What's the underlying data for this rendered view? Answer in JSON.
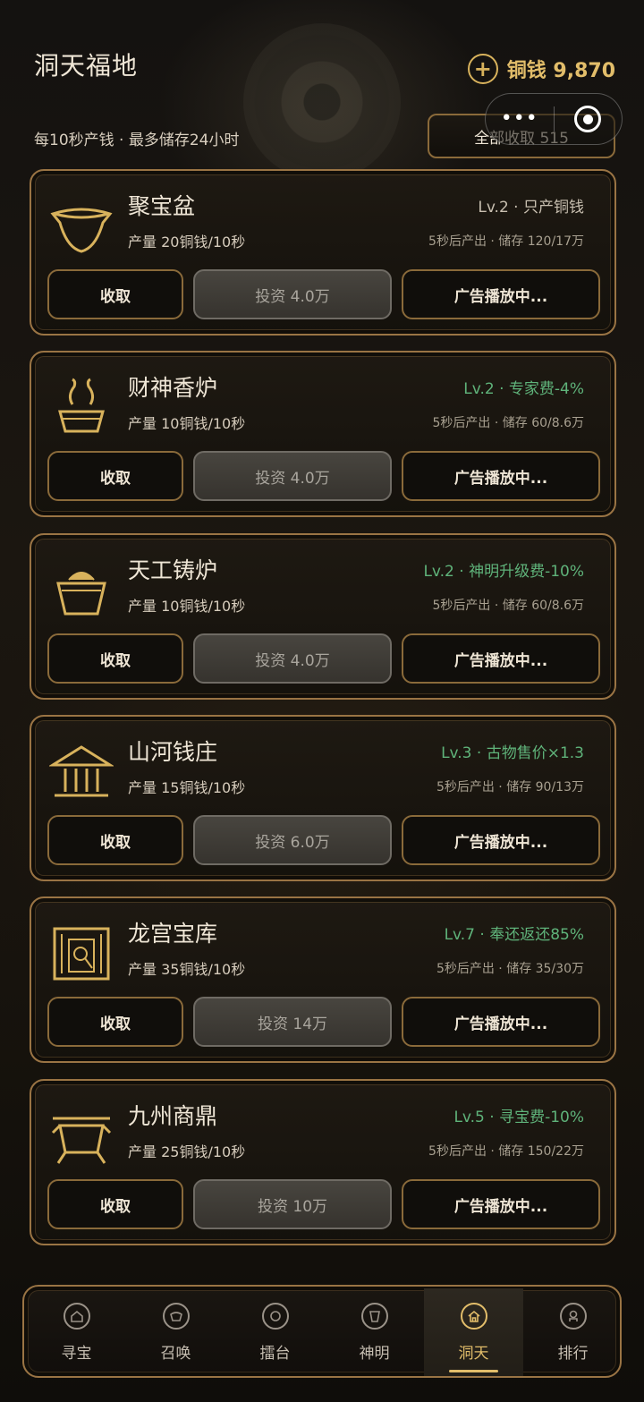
{
  "header": {
    "title": "洞天福地",
    "coin_plus": "+",
    "coin_label": "铜钱 9,870",
    "subtitle": "每10秒产钱 · 最多储存24小时",
    "collect_all": "全部收取 515"
  },
  "capsule": {
    "more": "•••",
    "close_icon": "target-icon"
  },
  "cards": [
    {
      "icon": "bowl-icon",
      "name": "聚宝盆",
      "prod": "产量 20铜钱/10秒",
      "tag": "Lv.2 · 只产铜钱",
      "tag_color": "#c8bfb0",
      "store": "5秒后产出 · 储存 120/17万",
      "collect": "收取",
      "invest": "投资 4.0万",
      "ad": "广告播放中..."
    },
    {
      "icon": "incense-burner-icon",
      "name": "财神香炉",
      "prod": "产量 10铜钱/10秒",
      "tag": "Lv.2 · 专家费-4%",
      "tag_color": "#5fb37a",
      "store": "5秒后产出 · 储存 60/8.6万",
      "collect": "收取",
      "invest": "投资 4.0万",
      "ad": "广告播放中..."
    },
    {
      "icon": "furnace-icon",
      "name": "天工铸炉",
      "prod": "产量 10铜钱/10秒",
      "tag": "Lv.2 · 神明升级费-10%",
      "tag_color": "#5fb37a",
      "store": "5秒后产出 · 储存 60/8.6万",
      "collect": "收取",
      "invest": "投资 4.0万",
      "ad": "广告播放中..."
    },
    {
      "icon": "bank-icon",
      "name": "山河钱庄",
      "prod": "产量 15铜钱/10秒",
      "tag": "Lv.3 · 古物售价×1.3",
      "tag_color": "#5fb37a",
      "store": "5秒后产出 · 储存 90/13万",
      "collect": "收取",
      "invest": "投资 6.0万",
      "ad": "广告播放中..."
    },
    {
      "icon": "vault-icon",
      "name": "龙宫宝库",
      "prod": "产量 35铜钱/10秒",
      "tag": "Lv.7 · 奉还返还85%",
      "tag_color": "#5fb37a",
      "store": "5秒后产出 · 储存 35/30万",
      "collect": "收取",
      "invest": "投资 14万",
      "ad": "广告播放中..."
    },
    {
      "icon": "cauldron-icon",
      "name": "九州商鼎",
      "prod": "产量 25铜钱/10秒",
      "tag": "Lv.5 · 寻宝费-10%",
      "tag_color": "#5fb37a",
      "store": "5秒后产出 · 储存 150/22万",
      "collect": "收取",
      "invest": "投资 10万",
      "ad": "广告播放中..."
    }
  ],
  "tabs": [
    {
      "label": "寻宝",
      "icon": "treasure-hunt-icon",
      "active": false
    },
    {
      "label": "召唤",
      "icon": "summon-icon",
      "active": false
    },
    {
      "label": "擂台",
      "icon": "arena-icon",
      "active": false
    },
    {
      "label": "神明",
      "icon": "deity-icon",
      "active": false
    },
    {
      "label": "洞天",
      "icon": "home-icon",
      "active": true
    },
    {
      "label": "排行",
      "icon": "ranking-icon",
      "active": false
    }
  ],
  "colors": {
    "gold": "#e2bd6a",
    "border": "#9a7444",
    "green": "#5fb37a"
  }
}
